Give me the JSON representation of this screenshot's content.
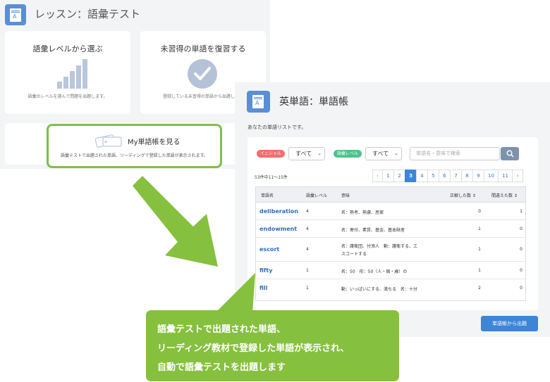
{
  "lesson": {
    "title": "レッスン：語彙テスト",
    "book_icon_letter": "A",
    "card_level": {
      "title": "語彙レベルから選ぶ",
      "desc": "語彙のレベルを選んで問題を出題します。",
      "icon": "bar-chart-icon"
    },
    "card_review": {
      "title": "未習得の単語を復習する",
      "desc": "登録している未習得の単語から出題します",
      "icon": "checkmark-icon"
    },
    "card_mybook": {
      "title": "My単語帳を見る",
      "desc": "語彙テストで出題された単語、リーディングで登録した単語が表示されます。",
      "icon": "tag-icon",
      "highlight_color": "#7fbf4a"
    }
  },
  "vocab": {
    "title": "英単語：単語帳",
    "book_icon_letter": "A",
    "subtitle": "あなたの単語リストです。",
    "filters": {
      "initial_label": "イニシャル",
      "initial_value": "すべて",
      "level_label": "語彙レベル",
      "level_value": "すべて",
      "search_placeholder": "単語名・意味で検索"
    },
    "result_count": "53件中11〜15件",
    "pagination": {
      "prev": "‹",
      "pages": [
        "1",
        "2",
        "3",
        "4",
        "5",
        "6",
        "7",
        "8",
        "9",
        "10",
        "11"
      ],
      "current": "3",
      "next": "›"
    },
    "table": {
      "columns": [
        "単語名",
        "語彙レベル",
        "意味",
        "正解した数 ⇕",
        "間違えた数 ⇕"
      ],
      "rows": [
        {
          "word": "deliberation",
          "level": "4",
          "meaning": [
            "名：熟考、熟慮、思案"
          ],
          "correct": "0",
          "wrong": "1"
        },
        {
          "word": "endowment",
          "level": "4",
          "meaning": [
            "名：寄付、素質、基金、基本財産"
          ],
          "correct": "1",
          "wrong": "0"
        },
        {
          "word": "escort",
          "level": "4",
          "meaning": [
            "名：護衛団、付添人　動：護衛する、エ",
            "スコートする"
          ],
          "correct": "1",
          "wrong": "0"
        },
        {
          "word": "fifty",
          "level": "1",
          "meaning": [
            "名：50　形：50（人・個・歳）の"
          ],
          "correct": "1",
          "wrong": "0"
        },
        {
          "word": "fill",
          "level": "1",
          "meaning": [
            "動：いっぱいにする、満ちる　名：十分"
          ],
          "correct": "2",
          "wrong": "0"
        }
      ]
    },
    "quiz_button": "単語帳から出題",
    "accent_color": "#3d85d6"
  },
  "callout": {
    "lines": [
      "語彙テストで出題された単語、",
      "リーディング教材で登録した単語が表示され、",
      "自動で語彙テストを出題します"
    ],
    "color": "#86c03f"
  },
  "arrow": {
    "icon": "down-right-arrow-icon",
    "color": "#86c03f"
  }
}
